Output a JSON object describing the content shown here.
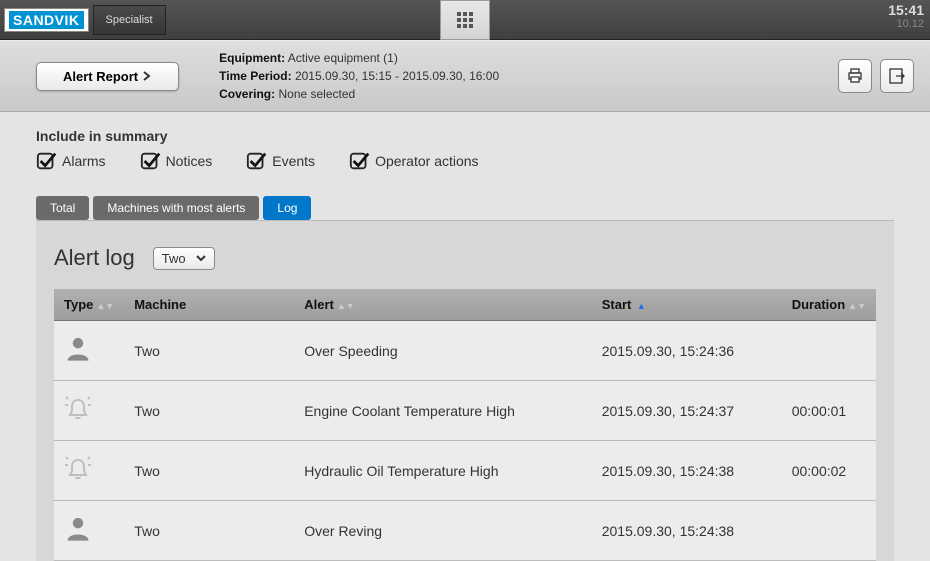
{
  "topbar": {
    "brand": "SANDVIK",
    "role": "Specialist",
    "time": "15:41",
    "date": "10.12"
  },
  "info": {
    "alert_report_label": "Alert Report",
    "equipment_label": "Equipment:",
    "equipment_value": "Active equipment (1)",
    "time_period_label": "Time Period:",
    "time_period_value": "2015.09.30, 15:15 - 2015.09.30, 16:00",
    "covering_label": "Covering:",
    "covering_value": "None selected"
  },
  "summary": {
    "title": "Include in summary",
    "options": [
      {
        "label": "Alarms",
        "checked": true
      },
      {
        "label": "Notices",
        "checked": true
      },
      {
        "label": "Events",
        "checked": true
      },
      {
        "label": "Operator actions",
        "checked": true
      }
    ]
  },
  "tabs": {
    "total": "Total",
    "machines": "Machines with most alerts",
    "log": "Log"
  },
  "panel": {
    "title": "Alert log",
    "dropdown_value": "Two"
  },
  "table": {
    "headers": {
      "type": "Type",
      "machine": "Machine",
      "alert": "Alert",
      "start": "Start",
      "duration": "Duration"
    },
    "rows": [
      {
        "type": "person",
        "machine": "Two",
        "alert": "Over Speeding",
        "start": "2015.09.30, 15:24:36",
        "duration": ""
      },
      {
        "type": "bell",
        "machine": "Two",
        "alert": "Engine Coolant Temperature High",
        "start": "2015.09.30, 15:24:37",
        "duration": "00:00:01"
      },
      {
        "type": "bell",
        "machine": "Two",
        "alert": "Hydraulic Oil Temperature High",
        "start": "2015.09.30, 15:24:38",
        "duration": "00:00:02"
      },
      {
        "type": "person",
        "machine": "Two",
        "alert": "Over Reving",
        "start": "2015.09.30, 15:24:38",
        "duration": ""
      }
    ]
  }
}
